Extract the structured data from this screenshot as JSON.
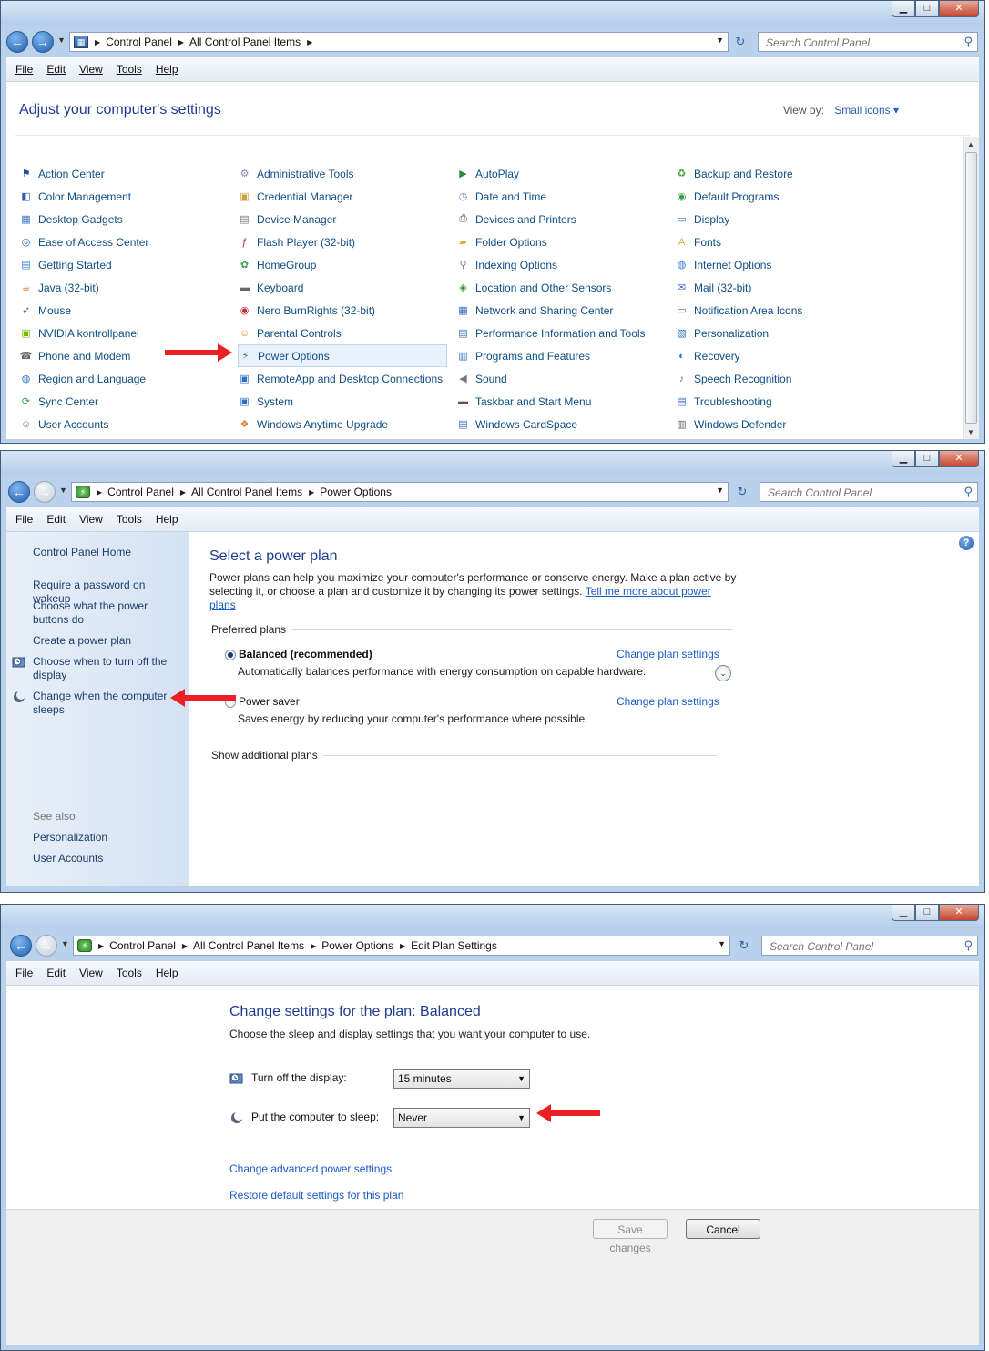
{
  "search_placeholder": "Search Control Panel",
  "menu": [
    "File",
    "Edit",
    "View",
    "Tools",
    "Help"
  ],
  "win1": {
    "crumbs": [
      "Control Panel",
      "All Control Panel Items"
    ],
    "heading": "Adjust your computer's settings",
    "view_by_label": "View by:",
    "view_by_value": "Small icons",
    "items": [
      {
        "label": "Action Center",
        "icon": "flag-icon",
        "color": "#1d4fa0"
      },
      {
        "label": "Administrative Tools",
        "icon": "admin-tools-icon",
        "color": "#7f8fa6"
      },
      {
        "label": "AutoPlay",
        "icon": "autoplay-icon",
        "color": "#2e8b3a"
      },
      {
        "label": "Backup and Restore",
        "icon": "backup-icon",
        "color": "#3a9a3a"
      },
      {
        "label": "Color Management",
        "icon": "color-management-icon",
        "color": "#2f5fb8"
      },
      {
        "label": "Credential Manager",
        "icon": "credential-icon",
        "color": "#c8a23a"
      },
      {
        "label": "Date and Time",
        "icon": "clock-icon",
        "color": "#6a8fc8"
      },
      {
        "label": "Default Programs",
        "icon": "default-programs-icon",
        "color": "#3aa04a"
      },
      {
        "label": "Desktop Gadgets",
        "icon": "gadgets-icon",
        "color": "#2f6fc0"
      },
      {
        "label": "Device Manager",
        "icon": "device-manager-icon",
        "color": "#777777"
      },
      {
        "label": "Devices and Printers",
        "icon": "printer-icon",
        "color": "#555555"
      },
      {
        "label": "Display",
        "icon": "display-icon",
        "color": "#2f6fc0"
      },
      {
        "label": "Ease of Access Center",
        "icon": "ease-of-access-icon",
        "color": "#2f6fc0"
      },
      {
        "label": "Flash Player (32-bit)",
        "icon": "flash-icon",
        "color": "#c8202a"
      },
      {
        "label": "Folder Options",
        "icon": "folder-icon",
        "color": "#d8b040"
      },
      {
        "label": "Fonts",
        "icon": "fonts-icon",
        "color": "#d8b040"
      },
      {
        "label": "Getting Started",
        "icon": "getting-started-icon",
        "color": "#3a8ad8"
      },
      {
        "label": "HomeGroup",
        "icon": "homegroup-icon",
        "color": "#3aa04a"
      },
      {
        "label": "Indexing Options",
        "icon": "indexing-icon",
        "color": "#888888"
      },
      {
        "label": "Internet Options",
        "icon": "internet-icon",
        "color": "#3a7ad8"
      },
      {
        "label": "Java (32-bit)",
        "icon": "java-icon",
        "color": "#d86a20"
      },
      {
        "label": "Keyboard",
        "icon": "keyboard-icon",
        "color": "#666666"
      },
      {
        "label": "Location and Other Sensors",
        "icon": "sensors-icon",
        "color": "#3a8a3a"
      },
      {
        "label": "Mail (32-bit)",
        "icon": "mail-icon",
        "color": "#3a6ac8"
      },
      {
        "label": "Mouse",
        "icon": "mouse-icon",
        "color": "#555555"
      },
      {
        "label": "Nero BurnRights (32-bit)",
        "icon": "nero-icon",
        "color": "#c82a2a"
      },
      {
        "label": "Network and Sharing Center",
        "icon": "network-icon",
        "color": "#2f6fc0"
      },
      {
        "label": "Notification Area Icons",
        "icon": "notification-icon",
        "color": "#2f6fc0"
      },
      {
        "label": "NVIDIA kontrollpanel",
        "icon": "nvidia-icon",
        "color": "#76b900"
      },
      {
        "label": "Parental Controls",
        "icon": "parental-icon",
        "color": "#d88a20"
      },
      {
        "label": "Performance Information and Tools",
        "icon": "performance-icon",
        "color": "#2f6fc0"
      },
      {
        "label": "Personalization",
        "icon": "personalization-icon",
        "color": "#2f6fc0"
      },
      {
        "label": "Phone and Modem",
        "icon": "phone-icon",
        "color": "#666666"
      },
      {
        "label": "Power Options",
        "icon": "power-options-icon",
        "color": "#2e8b3a"
      },
      {
        "label": "Programs and Features",
        "icon": "programs-icon",
        "color": "#2f6fc0"
      },
      {
        "label": "Recovery",
        "icon": "recovery-icon",
        "color": "#2f6fc0"
      },
      {
        "label": "Region and Language",
        "icon": "region-icon",
        "color": "#2f6fc0"
      },
      {
        "label": "RemoteApp and Desktop Connections",
        "icon": "remoteapp-icon",
        "color": "#2f6fc0"
      },
      {
        "label": "Sound",
        "icon": "speaker-icon",
        "color": "#777777"
      },
      {
        "label": "Speech Recognition",
        "icon": "microphone-icon",
        "color": "#777777"
      },
      {
        "label": "Sync Center",
        "icon": "sync-icon",
        "color": "#3aa04a"
      },
      {
        "label": "System",
        "icon": "system-icon",
        "color": "#2f6fc0"
      },
      {
        "label": "Taskbar and Start Menu",
        "icon": "taskbar-icon",
        "color": "#555555"
      },
      {
        "label": "Troubleshooting",
        "icon": "troubleshooting-icon",
        "color": "#2f6fc0"
      },
      {
        "label": "User Accounts",
        "icon": "user-accounts-icon",
        "color": "#3a8a3a"
      },
      {
        "label": "Windows Anytime Upgrade",
        "icon": "anytime-upgrade-icon",
        "color": "#e07a20"
      },
      {
        "label": "Windows CardSpace",
        "icon": "cardspace-icon",
        "color": "#2f6fc0"
      },
      {
        "label": "Windows Defender",
        "icon": "defender-icon",
        "color": "#666666"
      }
    ],
    "highlighted": "Power Options"
  },
  "win2": {
    "crumbs": [
      "Control Panel",
      "All Control Panel Items",
      "Power Options"
    ],
    "sidebar": {
      "home": "Control Panel Home",
      "links": [
        "Require a password on wakeup",
        "Choose what the power buttons do",
        "Create a power plan",
        "Choose when to turn off the display",
        "Change when the computer sleeps"
      ],
      "see_also": "See also",
      "see_also_links": [
        "Personalization",
        "User Accounts"
      ]
    },
    "title": "Select a power plan",
    "description": "Power plans can help you maximize your computer's performance or conserve energy. Make a plan active by selecting it, or choose a plan and customize it by changing its power settings.",
    "tell_me_more": "Tell me more about power plans",
    "preferred_plans": "Preferred plans",
    "plans": [
      {
        "name": "Balanced (recommended)",
        "desc": "Automatically balances performance with energy consumption on capable hardware.",
        "link": "Change plan settings",
        "selected": true
      },
      {
        "name": "Power saver",
        "desc": "Saves energy by reducing your computer's performance where possible.",
        "link": "Change plan settings",
        "selected": false
      }
    ],
    "show_additional": "Show additional plans"
  },
  "win3": {
    "crumbs": [
      "Control Panel",
      "All Control Panel Items",
      "Power Options",
      "Edit Plan Settings"
    ],
    "title": "Change settings for the plan: Balanced",
    "description": "Choose the sleep and display settings that you want your computer to use.",
    "display_label": "Turn off the display:",
    "display_value": "15 minutes",
    "sleep_label": "Put the computer to sleep:",
    "sleep_value": "Never",
    "advanced_link": "Change advanced power settings",
    "restore_link": "Restore default settings for this plan",
    "save_button": "Save changes",
    "cancel_button": "Cancel"
  },
  "accent_red": "#ec1f24"
}
